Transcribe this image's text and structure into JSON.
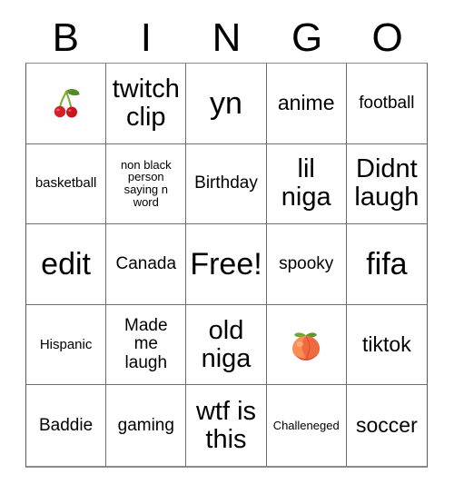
{
  "card": {
    "header_letters": [
      "B",
      "I",
      "N",
      "G",
      "O"
    ],
    "free_space_label": "Free!",
    "cells": [
      {
        "text": "",
        "icon": "cherries-emoji",
        "size": "emoji",
        "lines": 1
      },
      {
        "text": "twitch clip",
        "icon": "",
        "size": "fs-lg",
        "lines": 2
      },
      {
        "text": "yn",
        "icon": "",
        "size": "fs-xl",
        "lines": 1
      },
      {
        "text": "anime",
        "icon": "",
        "size": "fs-md",
        "lines": 1
      },
      {
        "text": "football",
        "icon": "",
        "size": "fs-sm",
        "lines": 1
      },
      {
        "text": "basketball",
        "icon": "",
        "size": "fs-xs",
        "lines": 1
      },
      {
        "text": "non black person saying n word",
        "icon": "",
        "size": "fs-xxs",
        "lines": 4
      },
      {
        "text": "Birthday",
        "icon": "",
        "size": "fs-sm",
        "lines": 1
      },
      {
        "text": "lil niga",
        "icon": "",
        "size": "fs-lg",
        "lines": 2
      },
      {
        "text": "Didnt laugh",
        "icon": "",
        "size": "fs-lg",
        "lines": 2
      },
      {
        "text": "edit",
        "icon": "",
        "size": "fs-xl",
        "lines": 1
      },
      {
        "text": "Canada",
        "icon": "",
        "size": "fs-sm",
        "lines": 1
      },
      {
        "text": "Free!",
        "icon": "",
        "size": "fs-xl",
        "lines": 1
      },
      {
        "text": "spooky",
        "icon": "",
        "size": "fs-sm",
        "lines": 1
      },
      {
        "text": "fifa",
        "icon": "",
        "size": "fs-xl",
        "lines": 1
      },
      {
        "text": "Hispanic",
        "icon": "",
        "size": "fs-xs",
        "lines": 1
      },
      {
        "text": "Made me laugh",
        "icon": "",
        "size": "fs-sm",
        "lines": 3
      },
      {
        "text": "old niga",
        "icon": "",
        "size": "fs-lg",
        "lines": 2
      },
      {
        "text": "",
        "icon": "peach-emoji",
        "size": "emoji",
        "lines": 1
      },
      {
        "text": "tiktok",
        "icon": "",
        "size": "fs-md",
        "lines": 1
      },
      {
        "text": "Baddie",
        "icon": "",
        "size": "fs-sm",
        "lines": 1
      },
      {
        "text": "gaming",
        "icon": "",
        "size": "fs-sm",
        "lines": 1
      },
      {
        "text": "wtf is this",
        "icon": "",
        "size": "fs-lg",
        "lines": 2
      },
      {
        "text": "Challeneged",
        "icon": "",
        "size": "fs-xxs",
        "lines": 1
      },
      {
        "text": "soccer",
        "icon": "",
        "size": "fs-md",
        "lines": 1
      }
    ]
  },
  "colors": {
    "background": "#ffffff",
    "text": "#000000",
    "grid_line": "#6e6e6e",
    "border_outer": "#8a8a8a",
    "cherry_red": "#d81e27",
    "cherry_stem_green": "#5a8f2a",
    "peach_orange": "#f98d52",
    "peach_red": "#ef4b34",
    "peach_leaf_green": "#6fa832"
  }
}
